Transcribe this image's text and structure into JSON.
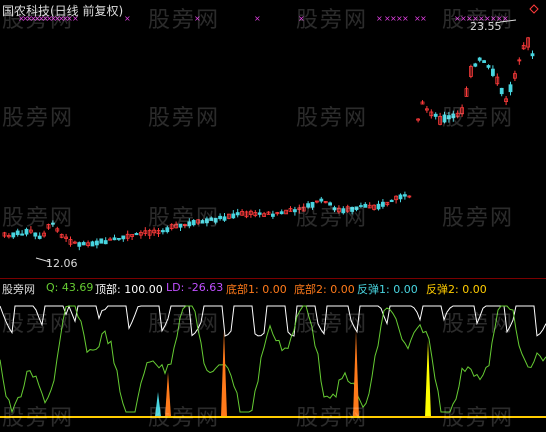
{
  "stock_title": "国农科技(日线 前复权)",
  "price_high_label": "23.55",
  "price_low_label": "12.06",
  "watermark": "股旁网",
  "indicator": {
    "name": "股旁网",
    "q": "Q: 43.69",
    "top": "顶部: 100.00",
    "ld": "LD: -26.63",
    "bottom1": "底部1: 0.00",
    "bottom2": "底部2: 0.00",
    "rebound1": "反弹1: 0.00",
    "rebound2": "反弹2: 0.00"
  },
  "colors": {
    "background": "#000000",
    "up_candle": "#ff3b3b",
    "down_candle": "#49d5e0",
    "q_line": "#66cc33",
    "top_line": "#ffffff",
    "ld_color": "#c050ff",
    "bottom1": "#ff7a1a",
    "bottom2": "#ff7a1a",
    "rebound1": "#ffff00",
    "rebound2": "#ffcc00",
    "marker_x": "#e040e0"
  }
}
